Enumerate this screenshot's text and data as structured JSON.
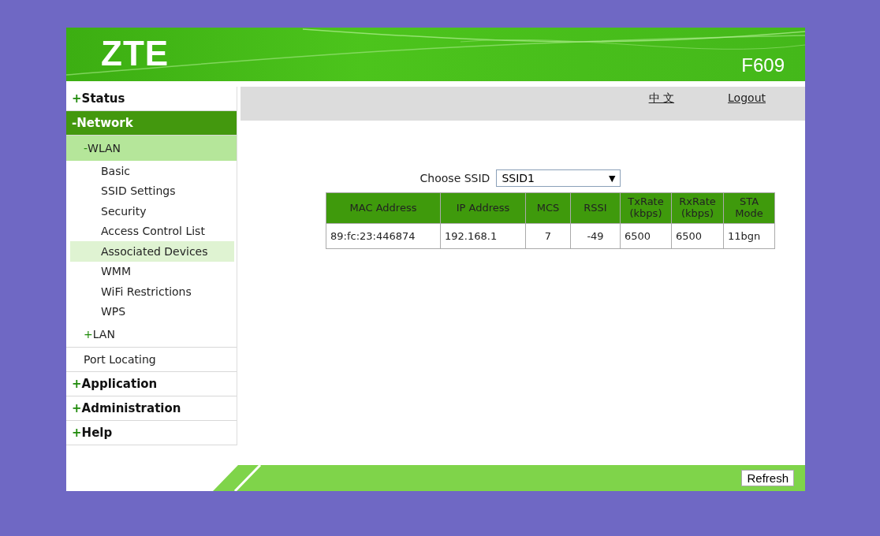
{
  "header": {
    "logo": "ZTE",
    "model": "F609"
  },
  "menu": [
    {
      "sign": "+",
      "label": "Status",
      "selected": false
    },
    {
      "sign": "-",
      "label": "Network",
      "selected": true,
      "children": [
        {
          "sign": "-",
          "label": "WLAN",
          "selected": true,
          "children": [
            {
              "label": "Basic",
              "selected": false
            },
            {
              "label": "SSID Settings",
              "selected": false
            },
            {
              "label": "Security",
              "selected": false
            },
            {
              "label": "Access Control List",
              "selected": false
            },
            {
              "label": "Associated Devices",
              "selected": true
            },
            {
              "label": "WMM",
              "selected": false
            },
            {
              "label": "WiFi Restrictions",
              "selected": false
            },
            {
              "label": "WPS",
              "selected": false
            }
          ]
        },
        {
          "sign": "+",
          "label": "LAN",
          "selected": false
        },
        {
          "label": "Port Locating",
          "selected": false
        }
      ]
    },
    {
      "sign": "+",
      "label": "Application",
      "selected": false
    },
    {
      "sign": "+",
      "label": "Administration",
      "selected": false
    },
    {
      "sign": "+",
      "label": "Help",
      "selected": false
    }
  ],
  "top_links": [
    "中 文",
    "Logout"
  ],
  "ssid": {
    "label": "Choose SSID",
    "value": "SSID1",
    "arrow": "▼"
  },
  "table": {
    "columns": [
      "MAC Address",
      "IP Address",
      "MCS",
      "RSSI",
      "TxRate (kbps)",
      "RxRate (kbps)",
      "STA Mode"
    ],
    "rows": [
      [
        "89:fc:23:446874",
        "192.168.1",
        "7",
        "-49",
        "6500",
        "6500",
        "11bgn"
      ]
    ]
  },
  "footer": {
    "button": "Refresh"
  }
}
